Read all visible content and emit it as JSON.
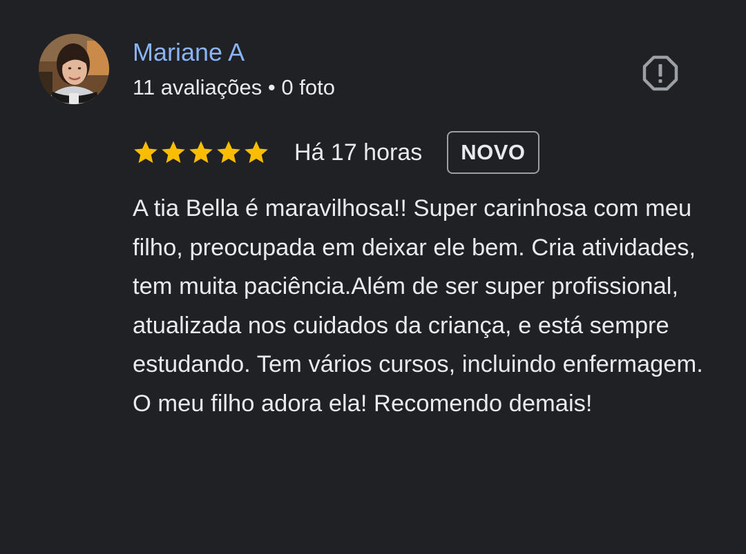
{
  "reviewer": {
    "name": "Mariane A",
    "reviews_count": "11 avaliações",
    "separator": "•",
    "photos_count": "0 foto",
    "avatar_icon": "user-avatar-photo"
  },
  "report": {
    "icon": "report-icon"
  },
  "rating": {
    "stars": 5,
    "max_stars": 5,
    "star_color": "#fbbc04",
    "time_ago": "Há 17 horas",
    "badge": "NOVO"
  },
  "review": {
    "paragraph_1": "A tia Bella é maravilhosa!! Super carinhosa com meu filho, preocupada em deixar ele bem. Cria atividades, tem muita paciência.Além de ser super profissional, atualizada nos cuidados da criança, e está sempre estudando. Tem vários cursos, incluindo enfermagem.",
    "paragraph_2": "O meu filho adora ela! Recomendo demais!"
  },
  "colors": {
    "background": "#202124",
    "name": "#8ab4f8",
    "text": "#e8eaed",
    "badge_border": "#9aa0a6",
    "icon": "#9aa0a6"
  }
}
